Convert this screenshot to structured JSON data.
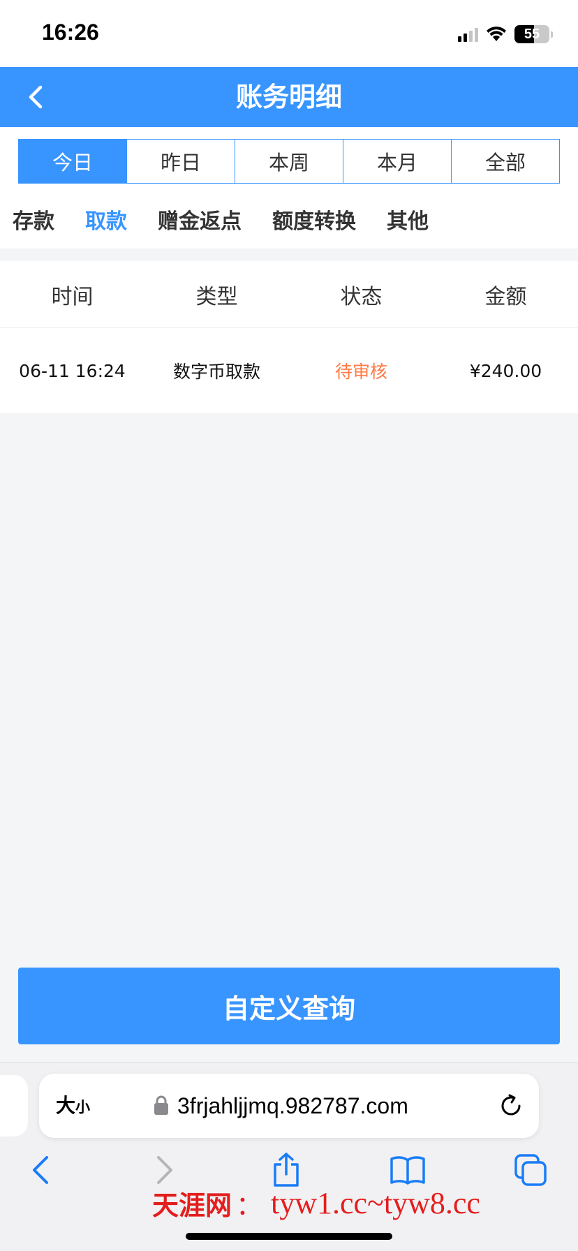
{
  "status_bar": {
    "time": "16:26",
    "battery": "55"
  },
  "header": {
    "title": "账务明细"
  },
  "date_tabs": [
    {
      "label": "今日",
      "active": true
    },
    {
      "label": "昨日",
      "active": false
    },
    {
      "label": "本周",
      "active": false
    },
    {
      "label": "本月",
      "active": false
    },
    {
      "label": "全部",
      "active": false
    }
  ],
  "category_tabs": [
    {
      "label": "存款",
      "active": false
    },
    {
      "label": "取款",
      "active": true
    },
    {
      "label": "赠金返点",
      "active": false
    },
    {
      "label": "额度转换",
      "active": false
    },
    {
      "label": "其他",
      "active": false
    }
  ],
  "table": {
    "columns": [
      "时间",
      "类型",
      "状态",
      "金额"
    ],
    "rows": [
      {
        "time": "06-11 16:24",
        "type": "数字币取款",
        "status": "待审核",
        "amount": "¥240.00"
      }
    ]
  },
  "query_button": {
    "label": "自定义查询"
  },
  "browser": {
    "text_size_big": "大",
    "text_size_small": "小",
    "url": "3frjahljjmq.982787.com"
  },
  "watermark": {
    "name": "天涯网",
    "separator": "：",
    "urls": "tyw1.cc~tyw8.cc"
  },
  "colors": {
    "primary": "#3895ff",
    "status_pending": "#ff7a45",
    "background": "#f4f5f7",
    "watermark": "#e41d1d"
  },
  "icons": [
    "back-arrow-icon",
    "lock-icon",
    "reload-icon",
    "browser-back-icon",
    "browser-forward-icon",
    "share-icon",
    "bookmarks-icon",
    "tabs-icon"
  ]
}
